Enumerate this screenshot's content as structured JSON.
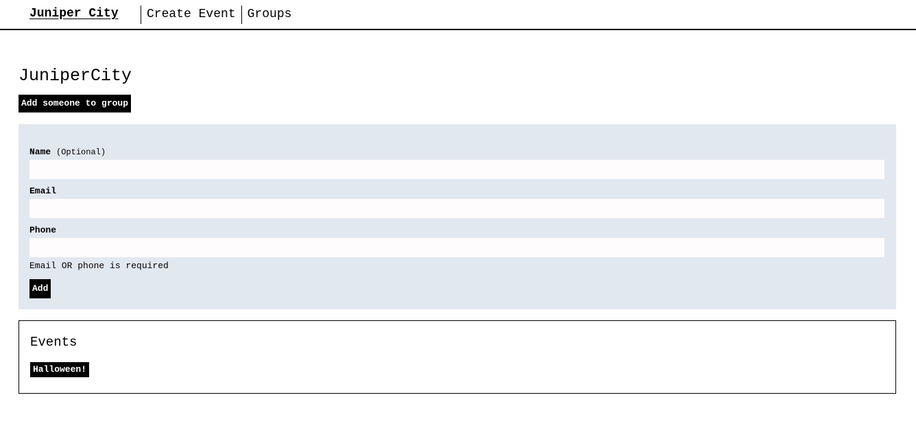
{
  "nav": {
    "brand": "Juniper City",
    "links": [
      {
        "label": "Create Event"
      },
      {
        "label": "Groups"
      }
    ]
  },
  "group": {
    "title": "JuniperCity",
    "add_someone_label": "Add someone to group"
  },
  "form": {
    "name_label": "Name",
    "name_optional": "(Optional)",
    "name_value": "",
    "email_label": "Email",
    "email_value": "",
    "phone_label": "Phone",
    "phone_value": "",
    "hint": "Email OR phone is required",
    "submit_label": "Add"
  },
  "events": {
    "title": "Events",
    "items": [
      {
        "label": "Halloween!"
      }
    ]
  },
  "colors": {
    "form_background": "#e2e8f0",
    "button_background": "#000000",
    "button_text": "#ffffff"
  }
}
